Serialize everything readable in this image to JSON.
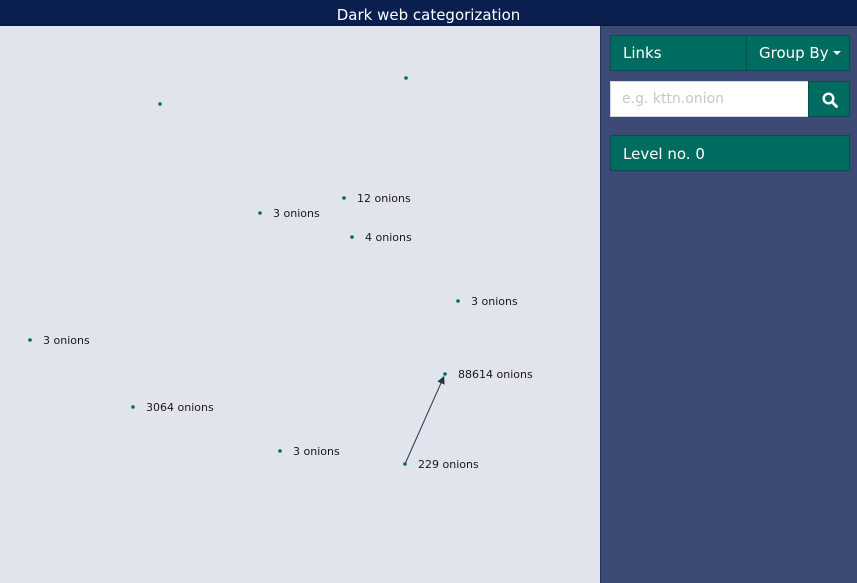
{
  "window": {
    "title": "Dark web categorization"
  },
  "sidebar": {
    "links_label": "Links",
    "group_by_label": "Group By",
    "search_placeholder": "e.g. kttn.onion",
    "level_label": "Level no. 0"
  },
  "colors": {
    "title_bar": "#0b1f4f",
    "canvas": "#e1e4ec",
    "sidebar": "#3d4a75",
    "accent": "#006b5f",
    "node": "#006b5f"
  },
  "icons": {
    "search": "magnifier-icon",
    "dropdown": "caret-down-icon"
  },
  "graph": {
    "nodes": [
      {
        "id": "n1",
        "label": ""
      },
      {
        "id": "n2",
        "label": ""
      },
      {
        "id": "n3",
        "label": "12 onions"
      },
      {
        "id": "n4",
        "label": "3 onions"
      },
      {
        "id": "n5",
        "label": "4 onions"
      },
      {
        "id": "n6",
        "label": "3 onions"
      },
      {
        "id": "n7",
        "label": "3 onions"
      },
      {
        "id": "n8",
        "label": "88614 onions"
      },
      {
        "id": "n9",
        "label": "3064 onions"
      },
      {
        "id": "n10",
        "label": "3 onions"
      },
      {
        "id": "n11",
        "label": "229 onions"
      }
    ],
    "edges": [
      {
        "from": "n11",
        "to": "n8",
        "directed": true
      }
    ]
  }
}
